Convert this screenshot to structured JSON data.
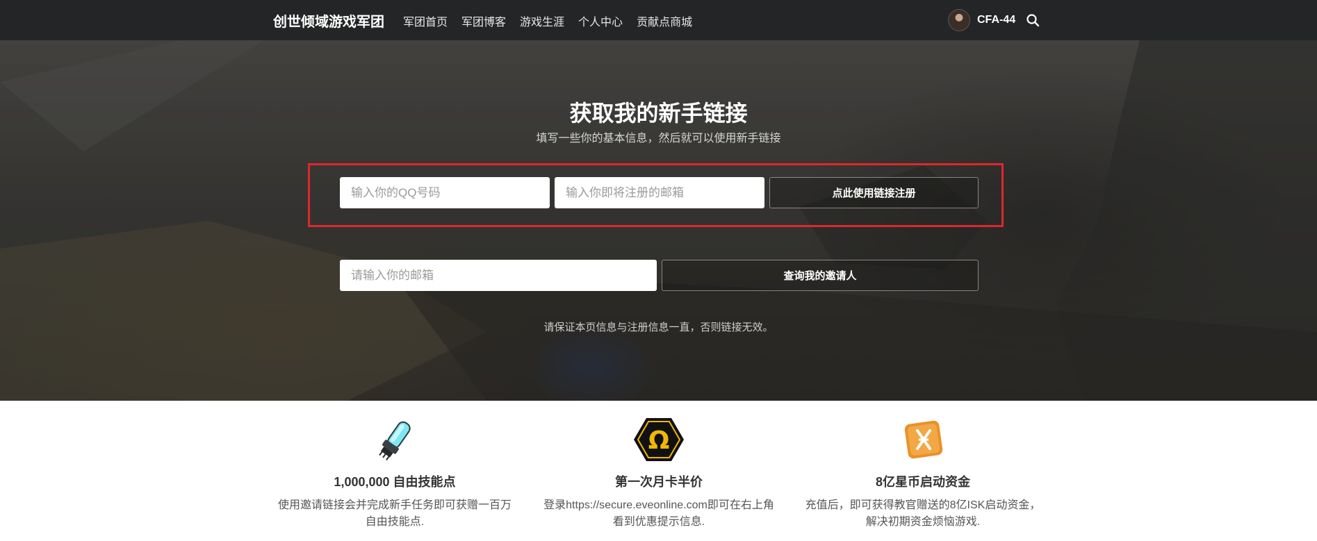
{
  "header": {
    "brand": "创世倾域游戏军团",
    "nav": [
      "军团首页",
      "军团博客",
      "游戏生涯",
      "个人中心",
      "贡献点商城"
    ],
    "username": "CFA-44"
  },
  "hero": {
    "title": "获取我的新手链接",
    "subtitle": "填写一些你的基本信息，然后就可以使用新手链接",
    "qq_placeholder": "输入你的QQ号码",
    "email_placeholder": "输入你即将注册的邮箱",
    "register_button": "点此使用链接注册",
    "query_email_placeholder": "请输入你的邮箱",
    "query_button": "查询我的邀请人",
    "notice": "请保证本页信息与注册信息一直，否则链接无效。"
  },
  "features": [
    {
      "icon": "skill-injector-icon",
      "title": "1,000,000 自由技能点",
      "desc_lines": [
        "使用邀请链接会并完成新手任务即可获赠一百万",
        "自由技能点."
      ]
    },
    {
      "icon": "omega-hexagon-icon",
      "title": "第一次月卡半价",
      "desc_lines": [
        "登录https://secure.eveonline.com即可在右上角",
        "看到优惠提示信息."
      ]
    },
    {
      "icon": "isk-cube-icon",
      "title": "8亿星币启动资金",
      "desc_lines": [
        "充值后，即可获得教官赠送的8亿ISK启动资金，",
        "解决初期资金烦恼游戏."
      ]
    }
  ],
  "colors": {
    "topbar": "#242526",
    "highlight": "#e0272a",
    "omega": "#f2b705",
    "isk": "#e8922a"
  }
}
